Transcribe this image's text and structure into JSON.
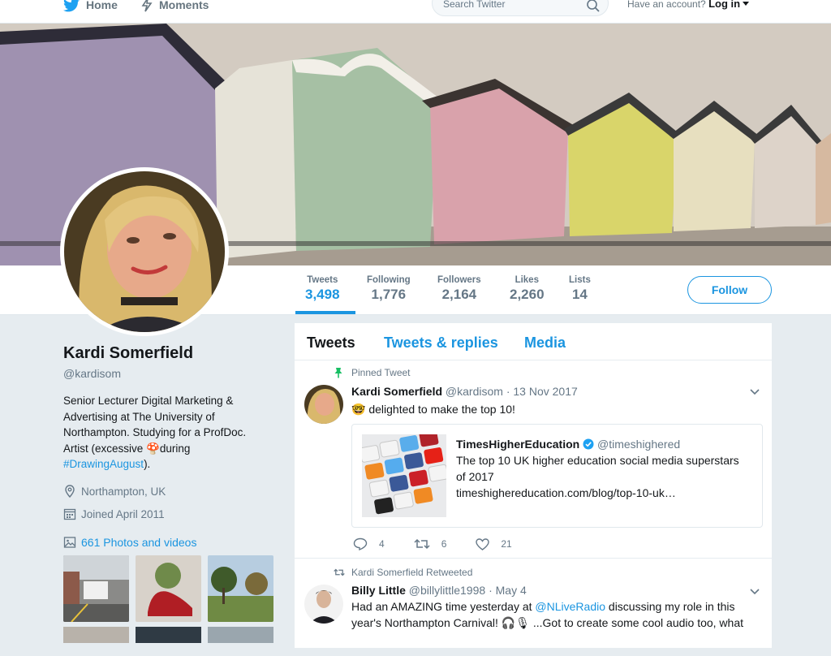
{
  "nav": {
    "home_label": "Home",
    "moments_label": "Moments",
    "search_placeholder": "Search Twitter",
    "account_prompt": "Have an account?",
    "login_label": "Log in"
  },
  "colors": {
    "accent": "#1b95e0",
    "text": "#14171a",
    "muted": "#657786",
    "background": "#e6ecf0"
  },
  "profile": {
    "name": "Kardi Somerfield",
    "handle": "@kardisom",
    "bio_text_1": "Senior Lecturer Digital Marketing & Advertising at The University of Northampton. Studying for a ProfDoc. Artist (excessive ",
    "bio_emoji": "🍄",
    "bio_text_2": "during ",
    "bio_hashtag": "#DrawingAugust",
    "bio_text_3": ").",
    "location": "Northampton, UK",
    "joined": "Joined April 2011",
    "photos_label": "661 Photos and videos"
  },
  "stats": [
    {
      "label": "Tweets",
      "value": "3,498"
    },
    {
      "label": "Following",
      "value": "1,776"
    },
    {
      "label": "Followers",
      "value": "2,164"
    },
    {
      "label": "Likes",
      "value": "2,260"
    },
    {
      "label": "Lists",
      "value": "14"
    }
  ],
  "follow_label": "Follow",
  "tabs": [
    "Tweets",
    "Tweets & replies",
    "Media"
  ],
  "tweets": [
    {
      "context": "Pinned Tweet",
      "name": "Kardi Somerfield",
      "handle": "@kardisom",
      "date": "· 13 Nov 2017",
      "emoji": "🤓",
      "text": "delighted to make the top 10!",
      "card": {
        "name": "TimesHigherEducation",
        "handle": "@timeshighered",
        "text": "The top 10 UK higher education social media superstars of 2017",
        "url": "timeshighereducation.com/blog/top-10-uk…"
      },
      "replies": "4",
      "retweets": "6",
      "likes": "21"
    },
    {
      "context": "Kardi Somerfield Retweeted",
      "name": "Billy Little",
      "handle": "@billylittle1998",
      "date": "· May 4",
      "text_1": "Had an AMAZING time yesterday at ",
      "mention": "@NLiveRadio",
      "text_2": " discussing my role in this year's Northampton Carnival! ",
      "emojis": "🎧🎙",
      "text_3": " ...Got to create some cool audio too, what"
    }
  ]
}
